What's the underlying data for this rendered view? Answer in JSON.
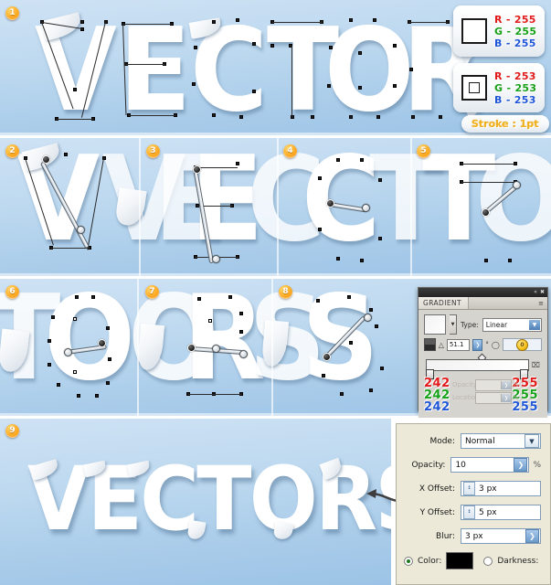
{
  "word": "VECTORS",
  "steps": [
    {
      "num": "1",
      "letters": "V E C T O R"
    },
    {
      "num": "2",
      "letters": "V"
    },
    {
      "num": "3",
      "letters": "E"
    },
    {
      "num": "4",
      "letters": "C"
    },
    {
      "num": "5",
      "letters": "T"
    },
    {
      "num": "6",
      "letters": "O"
    },
    {
      "num": "7",
      "letters": "R"
    },
    {
      "num": "8",
      "letters": "S"
    },
    {
      "num": "9",
      "letters": "VECTORS"
    }
  ],
  "callouts": {
    "fill": {
      "swatch_name": "fill-swatch-white",
      "r_label": "R - 255",
      "g_label": "G - 255",
      "b_label": "B - 255"
    },
    "stroke": {
      "swatch_name": "stroke-swatch-outline",
      "r_label": "R - 253",
      "g_label": "G - 253",
      "b_label": "B - 253"
    },
    "stroke_note": "Stroke : 1pt"
  },
  "gradient_panel": {
    "title": "GRADIENT",
    "type_label": "Type:",
    "type_value": "Linear",
    "angle_value": "51.1",
    "degree_symbol": "°",
    "aspect_value": "0",
    "opacity_label": "Opacity:",
    "location_label": "Location:",
    "percent_symbol": "%",
    "left_stop": {
      "r": "242",
      "g": "242",
      "b": "242"
    },
    "right_stop": {
      "r": "255",
      "g": "255",
      "b": "255"
    },
    "collapse_glyph": "«",
    "close_glyph": "✖",
    "menu_glyph": "≡",
    "dropdown_glyph": "▼",
    "step_glyph": "❯",
    "trash_glyph": "⌧"
  },
  "shadow_dialog": {
    "mode": {
      "label": "Mode:",
      "value": "Normal"
    },
    "opacity": {
      "label": "Opacity:",
      "value": "10",
      "suffix": "%"
    },
    "x_offset": {
      "label": "X Offset:",
      "value": "3 px"
    },
    "y_offset": {
      "label": "Y Offset:",
      "value": "5 px"
    },
    "blur": {
      "label": "Blur:",
      "value": "3 px"
    },
    "color": {
      "label": "Color:",
      "chip": "#000000",
      "selected": true
    },
    "darkness": {
      "label": "Darkness:",
      "selected": false
    },
    "dropdown_glyph": "▼",
    "step_glyph": "❯",
    "spin_glyph": "↕"
  },
  "colors": {
    "sky_top": "#cfe2f4",
    "sky_bottom": "#9cc3e6",
    "badge": "#ffb02a",
    "accent_red": "#e01b1b",
    "accent_green": "#17a018",
    "accent_blue": "#1f56d8",
    "dialog_bg": "#ece9d8",
    "panel_bg": "#d6d4ce"
  }
}
